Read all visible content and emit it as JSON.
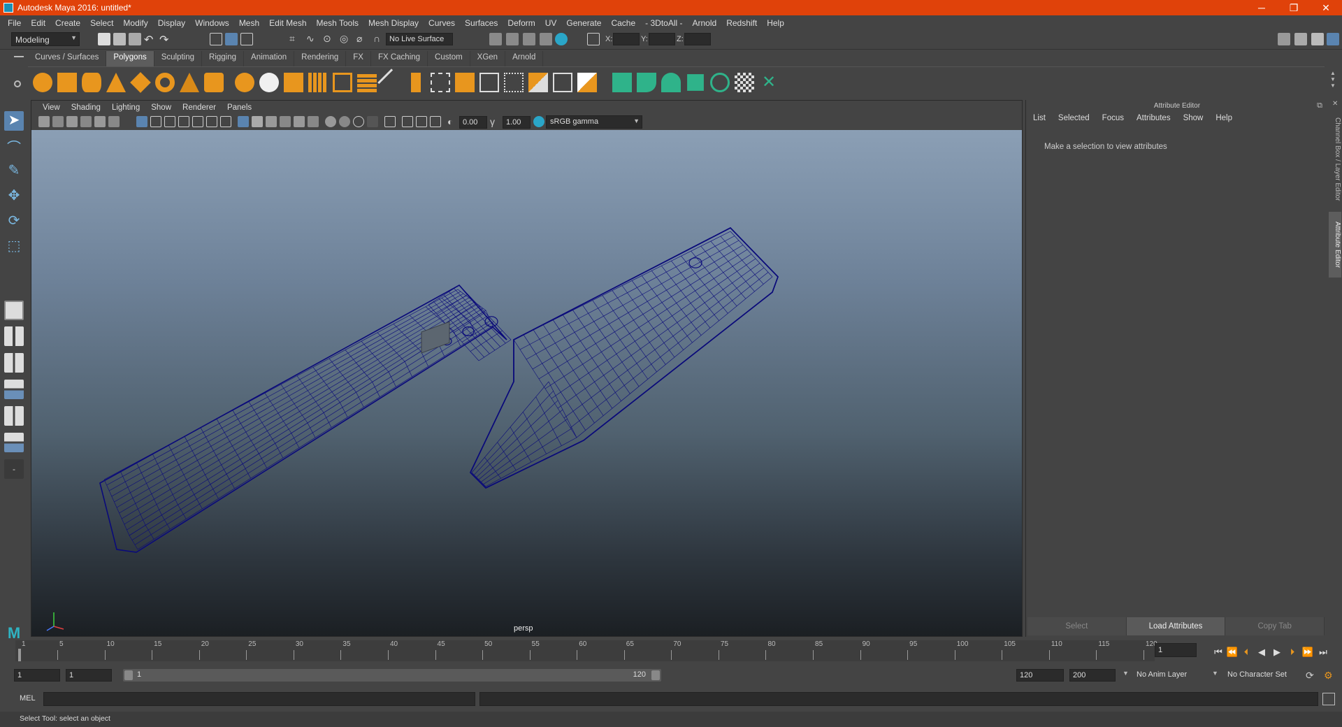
{
  "window": {
    "title": "Autodesk Maya 2016: untitled*",
    "controls": [
      "─",
      "❐",
      "✕"
    ]
  },
  "menubar": [
    "File",
    "Edit",
    "Create",
    "Select",
    "Modify",
    "Display",
    "Windows",
    "Mesh",
    "Edit Mesh",
    "Mesh Tools",
    "Mesh Display",
    "Curves",
    "Surfaces",
    "Deform",
    "UV",
    "Generate",
    "Cache",
    "- 3DtoAll -",
    "Arnold",
    "Redshift",
    "Help"
  ],
  "statusline": {
    "mode": "Modeling",
    "live_surface": "No Live Surface",
    "x_label": "X:",
    "y_label": "Y:",
    "z_label": "Z:"
  },
  "shelf": {
    "tabs": [
      "Curves / Surfaces",
      "Polygons",
      "Sculpting",
      "Rigging",
      "Animation",
      "Rendering",
      "FX",
      "FX Caching",
      "Custom",
      "XGen",
      "Arnold"
    ],
    "active_tab": "Polygons"
  },
  "panel": {
    "menus": [
      "View",
      "Shading",
      "Lighting",
      "Show",
      "Renderer",
      "Panels"
    ],
    "exposure": "0.00",
    "gamma": "1.00",
    "color_space": "sRGB gamma",
    "camera": "persp"
  },
  "attribute_editor": {
    "title": "Attribute Editor",
    "menus": [
      "List",
      "Selected",
      "Focus",
      "Attributes",
      "Show",
      "Help"
    ],
    "message": "Make a selection to view attributes",
    "buttons": [
      "Select",
      "Load Attributes",
      "Copy Tab"
    ]
  },
  "side_tabs": [
    "Channel Box / Layer Editor",
    "Attribute Editor"
  ],
  "timeline": {
    "ticks": [
      1,
      5,
      10,
      15,
      20,
      25,
      30,
      35,
      40,
      45,
      50,
      55,
      60,
      65,
      70,
      75,
      80,
      85,
      90,
      95,
      100,
      105,
      110,
      115,
      120
    ],
    "current_frame": "1"
  },
  "range": {
    "start": "1",
    "playback_start": "1",
    "slider_start": "1",
    "slider_end": "120",
    "playback_end": "120",
    "end": "200",
    "anim_layer": "No Anim Layer",
    "character_set": "No Character Set"
  },
  "command_line": {
    "label": "MEL"
  },
  "help_line": {
    "text": "Select Tool: select an object"
  },
  "colors": {
    "title_bar": "#e0420a",
    "wire": "#0a0a7a",
    "shelf_orange": "#e8961e",
    "shelf_green": "#2fb38a"
  }
}
